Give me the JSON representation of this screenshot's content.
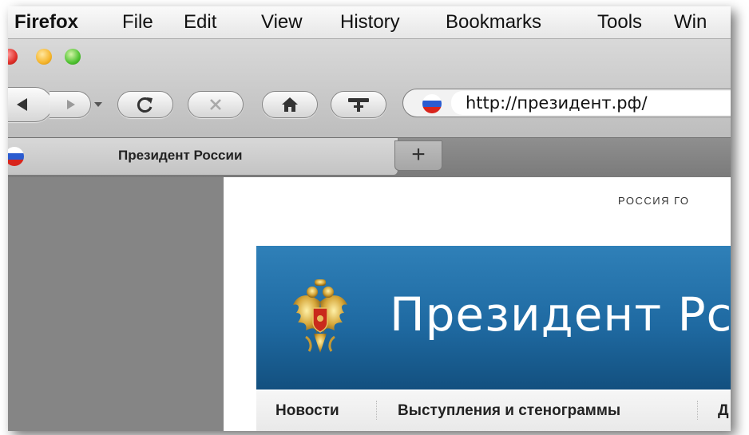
{
  "menubar": {
    "items": [
      "Firefox",
      "File",
      "Edit",
      "View",
      "History",
      "Bookmarks",
      "Tools",
      "Win"
    ]
  },
  "address_bar": {
    "url": "http://президент.рф/"
  },
  "tabs": [
    {
      "title": "Президент России"
    }
  ],
  "new_tab_label": "+",
  "page": {
    "top_nav": "РОССИЯ   ГО",
    "banner_title": "Президент Рс",
    "subnav": [
      "Новости",
      "Выступления и стенограммы",
      "Д"
    ]
  },
  "colors": {
    "banner": "#1f6aa2",
    "flag_white": "#ffffff",
    "flag_blue": "#2a5bd0",
    "flag_red": "#d8241c"
  },
  "icons": [
    "back-icon",
    "forward-icon",
    "dropdown-arrow-icon",
    "reload-icon",
    "stop-icon",
    "home-icon",
    "bookmark-toolbar-icon",
    "site-flag-icon",
    "emblem-icon"
  ]
}
